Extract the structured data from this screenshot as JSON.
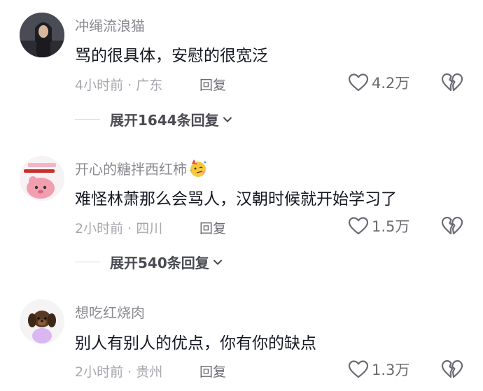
{
  "comments": [
    {
      "username": "冲绳流浪猫",
      "content": "骂的很具体，安慰的很宽泛",
      "meta": "4小时前 · 广东",
      "reply_label": "回复",
      "likes": "4.2万",
      "expand": "展开1644条回复",
      "avatar_icon": "user-photo-avatar"
    },
    {
      "username": "开心的糖拌西红柿",
      "username_emoji": "party-face-emoji",
      "content": "难怪林萧那么会骂人，汉朝时候就开始学习了",
      "meta": "2小时前 · 四川",
      "reply_label": "回复",
      "likes": "1.5万",
      "expand": "展开540条回复",
      "avatar_icon": "pink-cartoon-avatar"
    },
    {
      "username": "想吃红烧肉",
      "content": "别人有别人的优点，你有你的缺点",
      "meta": "2小时前 · 贵州",
      "reply_label": "回复",
      "likes": "1.3万",
      "avatar_icon": "puppy-avatar"
    }
  ],
  "colors": {
    "text_primary": "#161823",
    "text_secondary": "#8a8b91",
    "icon_stroke": "#6b6c73"
  }
}
